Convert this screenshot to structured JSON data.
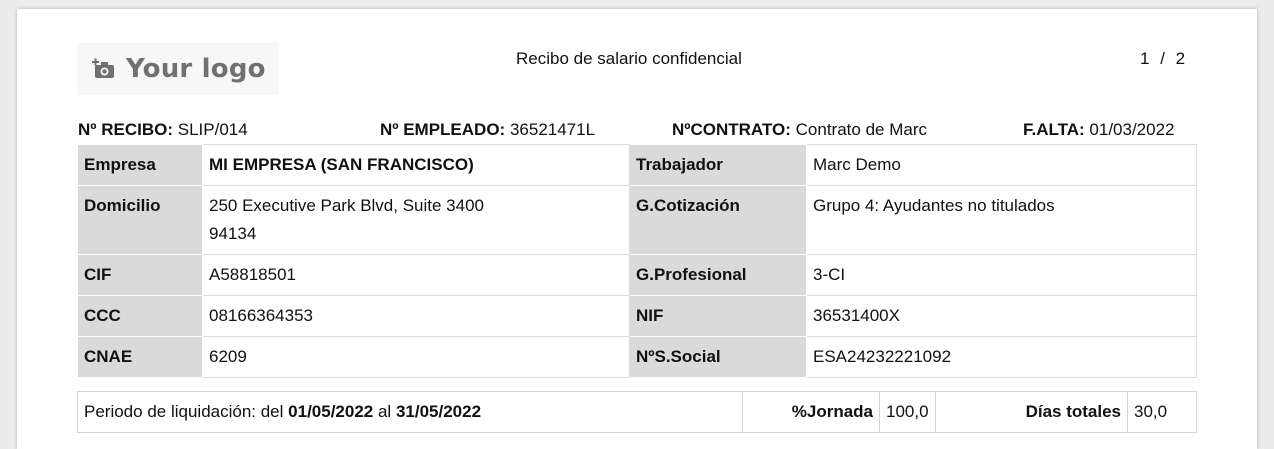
{
  "logo": {
    "text": "Your logo",
    "icon": "camera-add-icon"
  },
  "header": {
    "title": "Recibo de salario confidencial",
    "page_current": "1",
    "page_sep": "/",
    "page_total": "2"
  },
  "ids": {
    "recibo_label": "Nº RECIBO:",
    "recibo_value": "SLIP/014",
    "empleado_label": "Nº EMPLEADO:",
    "empleado_value": "36521471L",
    "contrato_label": "NºCONTRATO:",
    "contrato_value": "Contrato de Marc",
    "alta_label": "F.ALTA:",
    "alta_value": "01/03/2022"
  },
  "company": {
    "empresa_label": "Empresa",
    "empresa_value": "MI EMPRESA (SAN FRANCISCO)",
    "domicilio_label": "Domicilio",
    "domicilio_line1": "250 Executive Park Blvd, Suite 3400",
    "domicilio_line2": "94134",
    "cif_label": "CIF",
    "cif_value": "A58818501",
    "ccc_label": "CCC",
    "ccc_value": "08166364353",
    "cnae_label": "CNAE",
    "cnae_value": "6209"
  },
  "worker": {
    "trabajador_label": "Trabajador",
    "trabajador_value": "Marc Demo",
    "gcot_label": "G.Cotización",
    "gcot_value": "Grupo 4: Ayudantes no titulados",
    "gprof_label": "G.Profesional",
    "gprof_value": "3-CI",
    "nif_label": "NIF",
    "nif_value": "36531400X",
    "nss_label": "NºS.Social",
    "nss_value": "ESA24232221092"
  },
  "period": {
    "prefix": "Periodo de liquidación: del ",
    "from": "01/05/2022",
    "mid": " al ",
    "to": "31/05/2022",
    "jornada_label": "%Jornada",
    "jornada_value": "100,0",
    "dias_label": "Días totales",
    "dias_value": "30,0"
  }
}
